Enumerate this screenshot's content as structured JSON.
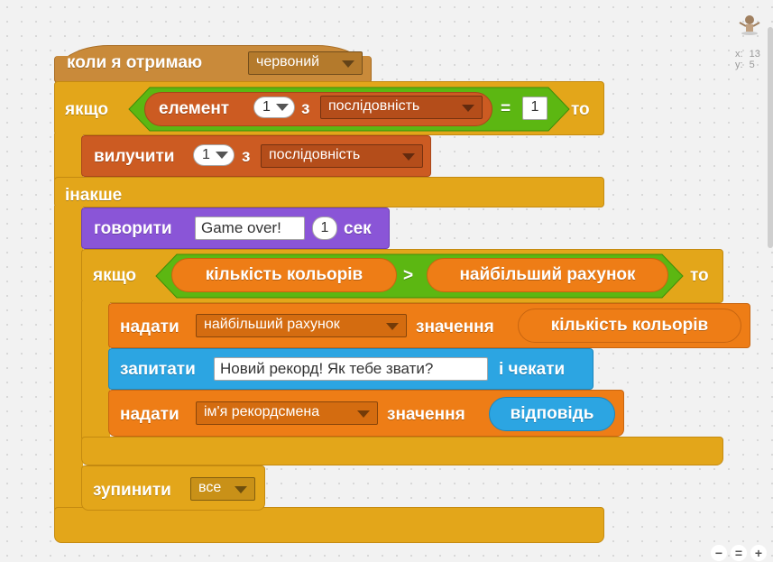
{
  "event_block": {
    "label": "коли я отримаю",
    "message": "червоний"
  },
  "if_else": {
    "if_label": "якщо",
    "then_label": "то",
    "else_label": "інакше",
    "condition": {
      "item_label": "елемент",
      "index": "1",
      "of_label": "з",
      "list": "послідовність",
      "op": "=",
      "value": "1"
    },
    "then_block": {
      "label": "вилучити",
      "index": "1",
      "of_label": "з",
      "list": "послідовність"
    }
  },
  "say_block": {
    "label": "говорити",
    "text": "Game over!",
    "secs": "1",
    "secs_label": "сек"
  },
  "inner_if": {
    "if_label": "якщо",
    "then_label": "то",
    "left": "кількість кольорів",
    "op": ">",
    "right": "найбільший рахунок"
  },
  "set_block_1": {
    "label": "надати",
    "variable": "найбільший рахунок",
    "to_label": "значення",
    "value": "кількість кольорів"
  },
  "ask_block": {
    "label": "запитати",
    "question": "Новий рекорд! Як тебе звати?",
    "wait_label": "і чекати"
  },
  "set_block_2": {
    "label": "надати",
    "variable": "ім'я рекордсмена",
    "to_label": "значення",
    "value": "відповідь"
  },
  "stop_block": {
    "label": "зупинити",
    "option": "все"
  },
  "sprite_info": {
    "x_label": "x:",
    "x_value": "13",
    "y_label": "y:",
    "y_value": "5"
  },
  "zoom": {
    "out": "−",
    "reset": "=",
    "in": "+"
  },
  "colors": {
    "control": "#e3a61a",
    "events": "#c98a3a",
    "lists": "#cc5b22",
    "looks": "#8a55d7",
    "data": "#ee7d16",
    "sensing": "#2ca5e2",
    "operators": "#5cb712"
  }
}
